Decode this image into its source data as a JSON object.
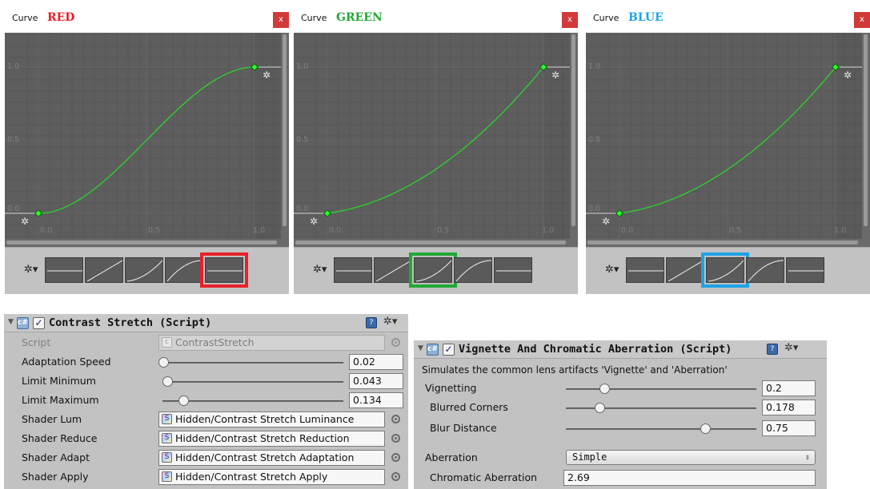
{
  "curves": [
    {
      "label": "Curve",
      "channel": "RED",
      "channel_color": "#e8202a",
      "close_label": "x",
      "y_ticks": [
        "1.0",
        "0.5",
        "0.0"
      ],
      "x_ticks": [
        "0.0",
        "0.5",
        "1.0"
      ],
      "curve_type": "s-curve",
      "selected_preset": 4,
      "highlight_color": "#e8202a"
    },
    {
      "label": "Curve",
      "channel": "GREEN",
      "channel_color": "#22a836",
      "close_label": "x",
      "y_ticks": [
        "1.0",
        "0.5",
        "0.0"
      ],
      "x_ticks": [
        "0.0",
        "0.5",
        "1.0"
      ],
      "curve_type": "ease-in",
      "selected_preset": 2,
      "highlight_color": "#22a836"
    },
    {
      "label": "Curve",
      "channel": "BLUE",
      "channel_color": "#1ea3e6",
      "close_label": "x",
      "y_ticks": [
        "1.0",
        "0.5",
        "0.0"
      ],
      "x_ticks": [
        "0.0",
        "0.5",
        "1.0"
      ],
      "curve_type": "ease-in",
      "selected_preset": 2,
      "highlight_color": "#1ea3e6"
    }
  ],
  "curve_color": "#28dc28",
  "preset_icon": "gear-dropdown-icon",
  "presets": [
    "constant",
    "linear",
    "ease-in",
    "ease-out",
    "ease-in-out"
  ],
  "contrast": {
    "title": "Contrast Stretch (Script)",
    "enabled": true,
    "script_label": "Script",
    "script_value": "ContrastStretch",
    "sliders": [
      {
        "label": "Adaptation Speed",
        "value": "0.02",
        "fraction": 0.02
      },
      {
        "label": "Limit Minimum",
        "value": "0.043",
        "fraction": 0.043
      },
      {
        "label": "Limit Maximum",
        "value": "0.134",
        "fraction": 0.134
      }
    ],
    "shaders": [
      {
        "label": "Shader Lum",
        "value": "Hidden/Contrast Stretch Luminance"
      },
      {
        "label": "Shader Reduce",
        "value": "Hidden/Contrast Stretch Reduction"
      },
      {
        "label": "Shader Adapt",
        "value": "Hidden/Contrast Stretch Adaptation"
      },
      {
        "label": "Shader Apply",
        "value": "Hidden/Contrast Stretch Apply"
      }
    ]
  },
  "vignette": {
    "title": "Vignette And Chromatic Aberration (Script)",
    "enabled": true,
    "description": "Simulates the common lens artifacts 'Vignette' and 'Aberration'",
    "sliders": [
      {
        "label": "Vignetting",
        "value": "0.2",
        "fraction": 0.2
      },
      {
        "label": "Blurred Corners",
        "value": "0.178",
        "fraction": 0.178
      },
      {
        "label": "Blur Distance",
        "value": "0.75",
        "fraction": 0.75
      }
    ],
    "aberration_label": "Aberration",
    "aberration_mode": "Simple",
    "chromatic_label": "Chromatic Aberration",
    "chromatic_value": "2.69"
  }
}
